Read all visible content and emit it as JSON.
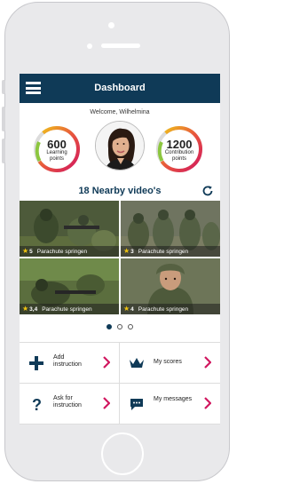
{
  "header": {
    "title": "Dashboard"
  },
  "welcome": "Welcome, Wilhelmina",
  "stats": {
    "learning": {
      "value": "600",
      "label_line1": "Learning",
      "label_line2": "points"
    },
    "contribution": {
      "value": "1200",
      "label_line1": "Contribution",
      "label_line2": "points"
    }
  },
  "videos": {
    "title": "18 Nearby video's",
    "items": [
      {
        "rating": "5",
        "title": "Parachute springen"
      },
      {
        "rating": "3",
        "title": "Parachute springen"
      },
      {
        "rating": "3,4",
        "title": "Parachute springen"
      },
      {
        "rating": "4",
        "title": "Parachute springen"
      }
    ]
  },
  "pager": {
    "pages": 3,
    "active": 1
  },
  "actions": {
    "add_instruction": {
      "line1": "Add",
      "line2": "instruction"
    },
    "my_scores": "My scores",
    "ask_instruction": {
      "line1": "Ask for",
      "line2": "instruction"
    },
    "my_messages": "My messages"
  },
  "colors": {
    "primary": "#0f3a57",
    "accent": "#d1175f",
    "star": "#f1c40f"
  }
}
